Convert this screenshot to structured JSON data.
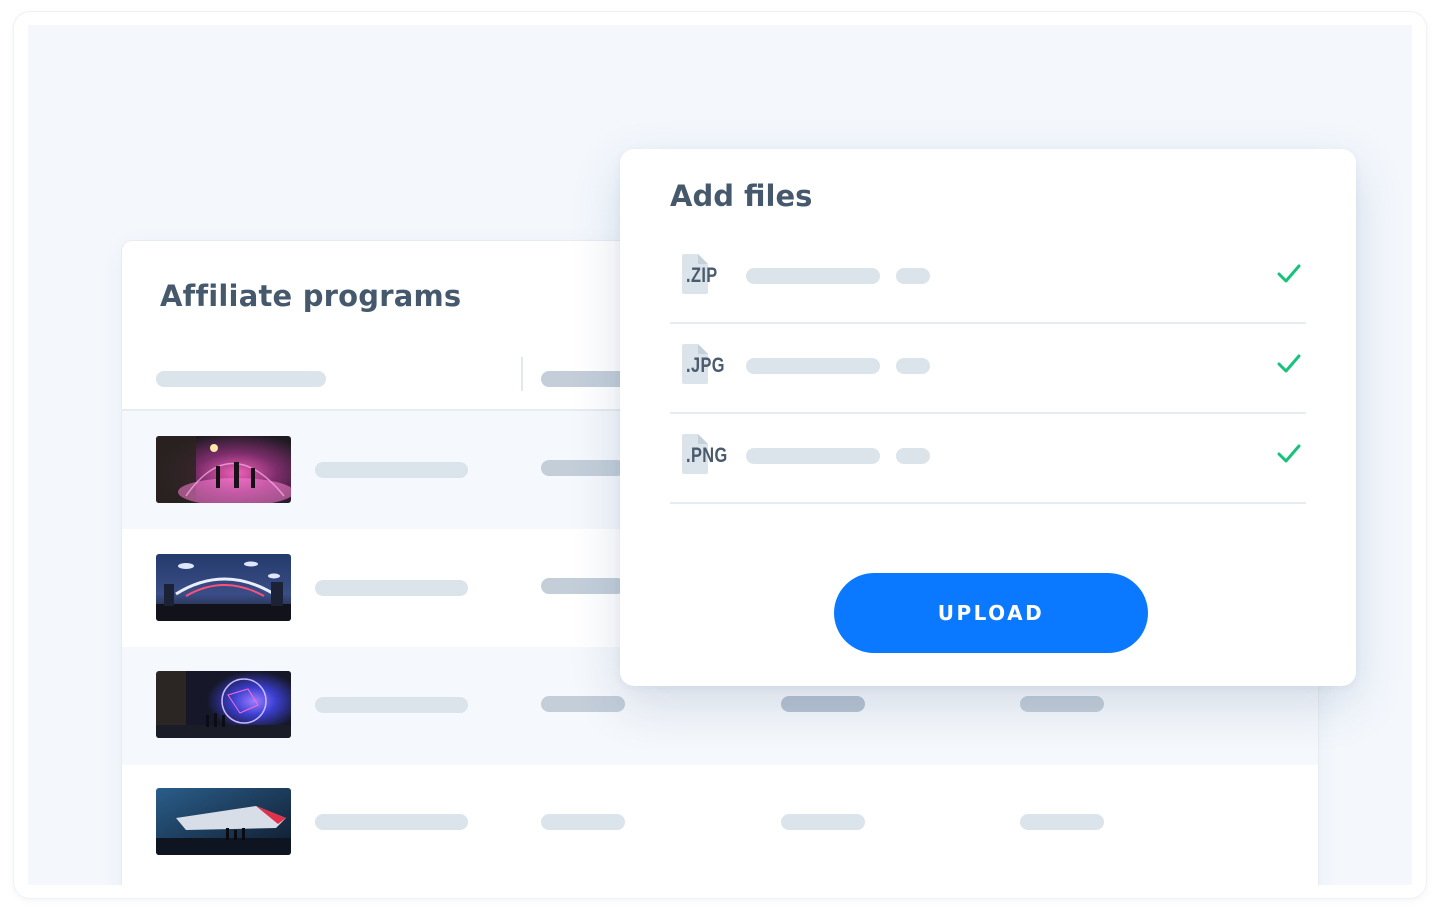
{
  "affiliate_card": {
    "title": "Affiliate programs",
    "rows": [
      {
        "thumbnail": "cyberpunk-dome-scene"
      },
      {
        "thumbnail": "futuristic-city-ships-scene"
      },
      {
        "thumbnail": "glowing-sphere-scene"
      },
      {
        "thumbnail": "hangar-spaceship-scene"
      }
    ]
  },
  "modal": {
    "title": "Add files",
    "files": [
      {
        "ext": ".ZIP",
        "status": "uploaded",
        "icon": "file-icon",
        "status_icon": "check-icon"
      },
      {
        "ext": ".JPG",
        "status": "uploaded",
        "icon": "file-icon",
        "status_icon": "check-icon"
      },
      {
        "ext": ".PNG",
        "status": "uploaded",
        "icon": "file-icon",
        "status_icon": "check-icon"
      }
    ],
    "upload_label": "UPLOAD"
  },
  "colors": {
    "accent": "#0a78ff",
    "check": "#17c27a",
    "title_text": "#45586c",
    "background": "#f4f8fd"
  }
}
